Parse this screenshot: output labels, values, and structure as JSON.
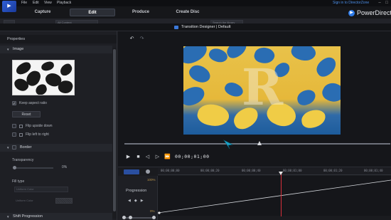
{
  "app": {
    "menu": [
      "File",
      "Edit",
      "View",
      "Playback"
    ],
    "signin": "Sign in to DirectorZone",
    "brand": "PowerDirector",
    "window_controls": [
      "minimize-icon",
      "maximize-icon",
      "close-icon"
    ]
  },
  "modes": [
    {
      "label": "Capture",
      "active": false
    },
    {
      "label": "Edit",
      "active": true
    },
    {
      "label": "Produce",
      "active": false
    },
    {
      "label": "Create Disc",
      "active": false
    }
  ],
  "app_strip": {
    "filter_label": "All Content",
    "search_placeholder": "Search the library"
  },
  "designer": {
    "title": "Transition Designer  |  Default"
  },
  "properties": {
    "header": "Properties",
    "image_section": "Image",
    "keep_aspect": {
      "label": "Keep aspect ratio",
      "checked": true
    },
    "reset_label": "Reset",
    "flip_ud": {
      "label": "Flip upside down",
      "checked": false
    },
    "flip_lr": {
      "label": "Flip left to right",
      "checked": false
    },
    "border_section": "Border",
    "border_checked": false,
    "transparency_label": "Transparency",
    "transparency_value": "0%",
    "transparency_fraction": 0.0,
    "fill_type_label": "Fill type",
    "fill_type_value": "Uniform Color",
    "uniform_color_label": "Uniform Color",
    "shift_section": "Shift Progression"
  },
  "player": {
    "timecode": "00;00;01;00",
    "controls": [
      "play-icon",
      "stop-icon",
      "prev-frame-icon",
      "next-frame-icon",
      "fast-forward-icon"
    ]
  },
  "timeline": {
    "ruler_labels": [
      "00;00;00;00",
      "00;00;00;20",
      "00;00;00;40",
      "00;00;01;00",
      "00;00;01;20",
      "00;00;01;40"
    ],
    "track_label": "Progression",
    "value_max": "100%",
    "value_min": "0%"
  },
  "colors": {
    "accent": "#2e7be8",
    "playhead": "#d8303a",
    "preview_yellow": "#e8c24a",
    "preview_blue": "#2a6db3"
  }
}
